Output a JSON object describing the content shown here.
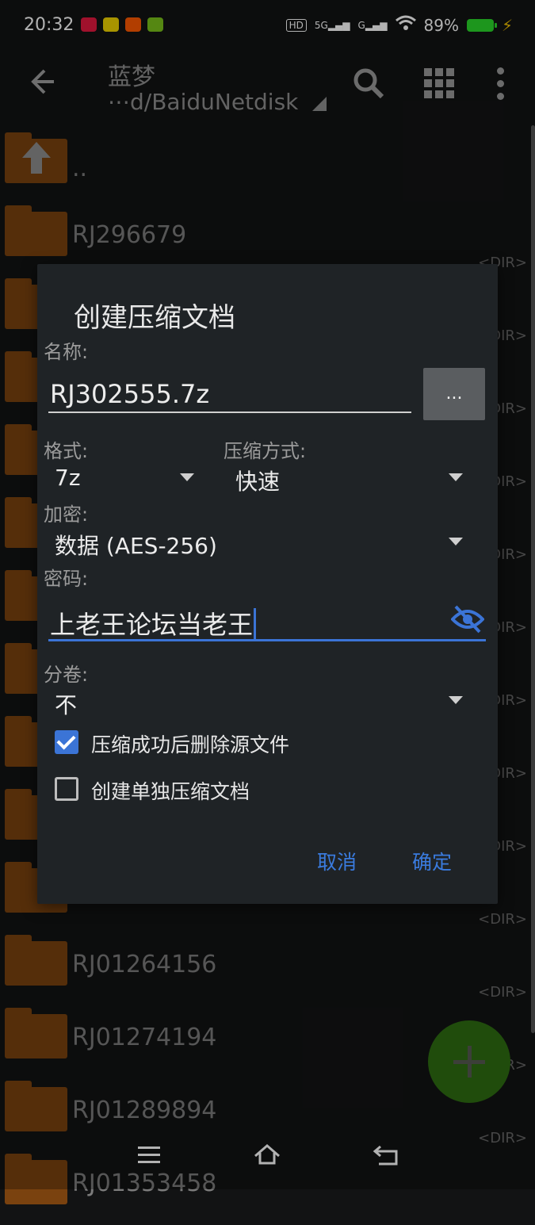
{
  "status_bar": {
    "time": "20:32",
    "hd_badge": "HD",
    "network_label": "5G",
    "network2_label": "G",
    "battery_text": "89%"
  },
  "app_bar": {
    "title": "蓝梦",
    "path": "⋯d/BaiduNetdisk"
  },
  "file_list": {
    "up_label": "..",
    "dir_tag": "<DIR>",
    "items": [
      "RJ296679",
      "",
      "",
      "",
      "",
      "",
      "",
      "",
      "",
      "",
      "RJ01264156",
      "RJ01274194",
      "RJ01289894",
      "RJ01353458"
    ]
  },
  "dialog": {
    "title": "创建压缩文档",
    "name_label": "名称:",
    "name_value": "RJ302555.7z",
    "browse_label": "...",
    "format_label": "格式:",
    "format_value": "7z",
    "method_label": "压缩方式:",
    "method_value": "快速",
    "encryption_label": "加密:",
    "encryption_value": "数据 (AES-256)",
    "password_label": "密码:",
    "password_value": "上老王论坛当老王",
    "split_label": "分卷:",
    "split_value": "不",
    "delete_source_label": "压缩成功后删除源文件",
    "delete_source_checked": true,
    "separate_label": "创建单独压缩文档",
    "separate_checked": false,
    "cancel_label": "取消",
    "ok_label": "确定"
  },
  "colors": {
    "accent": "#3b74d6",
    "folder": "#7a420f",
    "fab": "#2e6d12",
    "battery": "#2ad72a"
  }
}
